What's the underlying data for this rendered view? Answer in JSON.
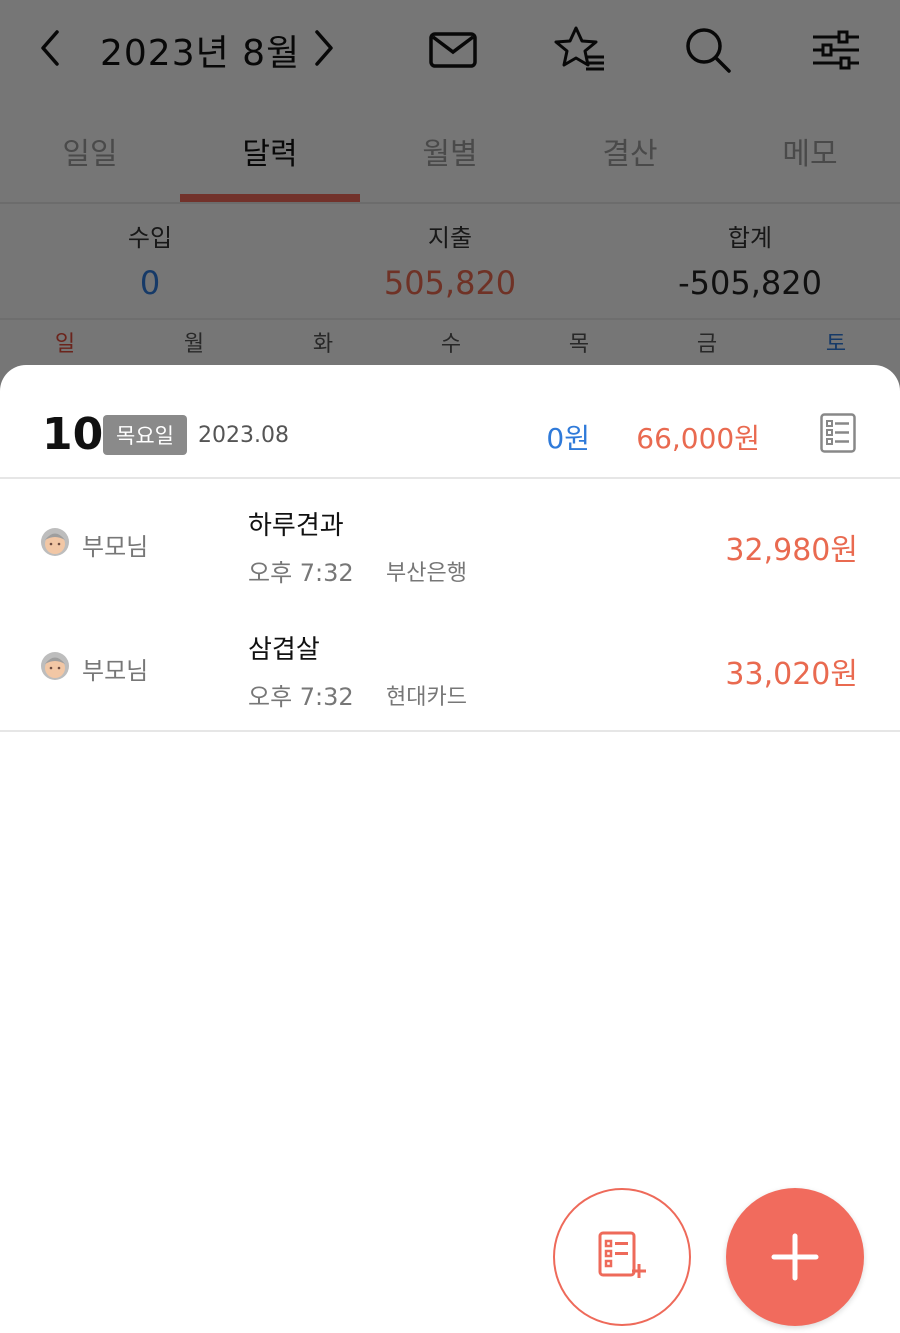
{
  "colors": {
    "accent": "#ee6a5a",
    "income": "#2f7ad9",
    "expense": "#e96a50",
    "sunday": "#e04b3b",
    "saturday": "#2f7ad9"
  },
  "header": {
    "month": "2023년 8월",
    "icons": [
      "chevron-left-icon",
      "chevron-right-icon",
      "mail-icon",
      "star-list-icon",
      "search-icon",
      "settings-sliders-icon"
    ]
  },
  "tabs": [
    {
      "label": "일일",
      "active": false
    },
    {
      "label": "달력",
      "active": true
    },
    {
      "label": "월별",
      "active": false
    },
    {
      "label": "결산",
      "active": false
    },
    {
      "label": "메모",
      "active": false
    }
  ],
  "summary": {
    "income_label": "수입",
    "income_value": "0",
    "expense_label": "지출",
    "expense_value": "505,820",
    "total_label": "합계",
    "total_value": "-505,820"
  },
  "weekdays": [
    "일",
    "월",
    "화",
    "수",
    "목",
    "금",
    "토"
  ],
  "day": {
    "number": "10",
    "weekday": "목요일",
    "date": "2023.08",
    "income": "0원",
    "expense": "66,000원",
    "transactions": [
      {
        "member": "부모님",
        "title": "하루견과",
        "time": "오후 7:32",
        "account": "부산은행",
        "amount": "32,980원"
      },
      {
        "member": "부모님",
        "title": "삼겹살",
        "time": "오후 7:32",
        "account": "현대카드",
        "amount": "33,020원"
      }
    ]
  }
}
